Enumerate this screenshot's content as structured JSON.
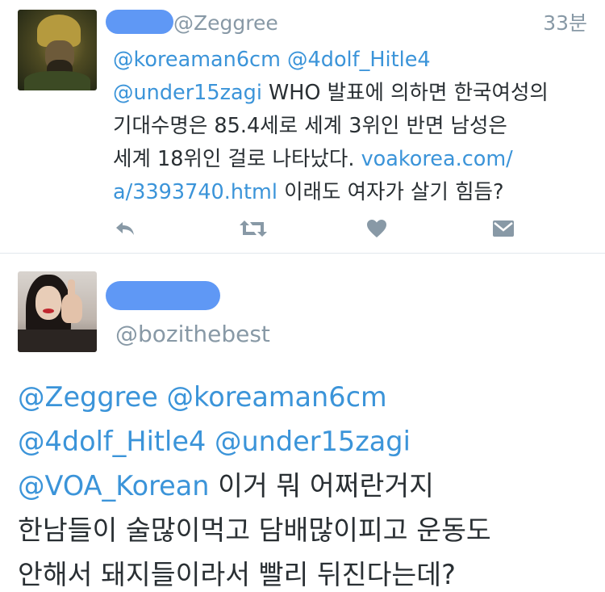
{
  "tweet1": {
    "handle": "@Zeggree",
    "timestamp": "33분",
    "line1": {
      "m1": "@koreaman6cm",
      "m2": "@4dolf_Hitle4"
    },
    "line2": {
      "m3": "@under15zagi",
      "text": " WHO 발표에 의하면 한국여성의"
    },
    "line3": "기대수명은 85.4세로 세계 3위인 반면 남성은",
    "line4": {
      "text": "세계 18위인 걸로 나타났다. ",
      "link1": "voakorea.com/"
    },
    "line5": {
      "link2": "a/3393740.html",
      "text": " 이래도 여자가 살기 힘듬?"
    },
    "actions": [
      "reply-icon",
      "retweet-icon",
      "like-icon",
      "message-icon"
    ]
  },
  "tweet2": {
    "handle": "@bozithebest",
    "line1": {
      "m1": "@Zeggree",
      "m2": "@koreaman6cm"
    },
    "line2": {
      "m3": "@4dolf_Hitle4",
      "m4": "@under15zagi"
    },
    "line3": {
      "m5": "@VOA_Korean",
      "text": " 이거 뭐 어쩌란거지"
    },
    "line4": "한남들이 술많이먹고 담배많이피고 운동도",
    "line5": "안해서 돼지들이라서 빨리 뒤진다는데?"
  },
  "colors": {
    "link": "#3b94d9",
    "meta_gray": "#8899a6",
    "redaction": "#5f98f5",
    "text": "#292f33",
    "divider": "#e1e8ed"
  }
}
